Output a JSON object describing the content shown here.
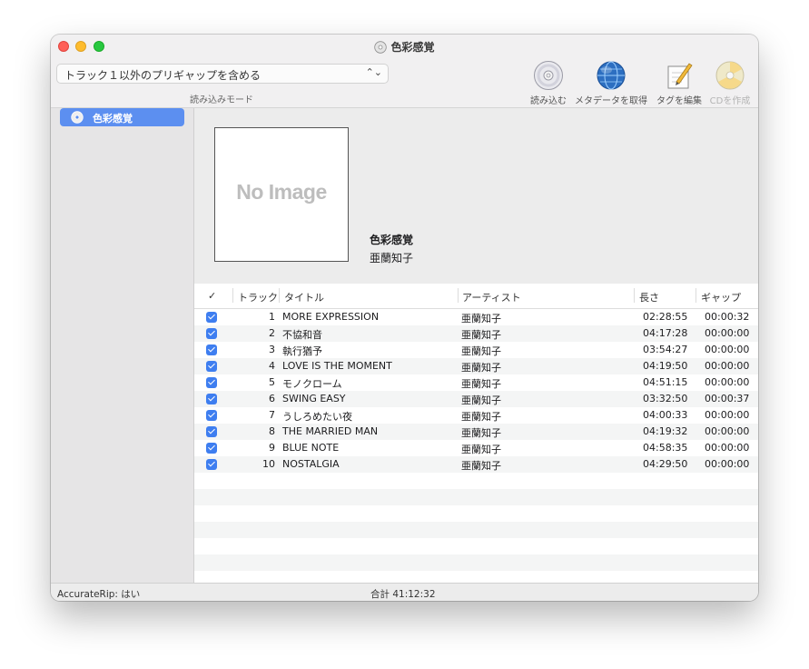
{
  "window": {
    "title": "色彩感覚"
  },
  "toolbar": {
    "mode_value": "トラック１以外のプリギャップを含める",
    "mode_label": "読み込みモード",
    "buttons": [
      {
        "label": "読み込む",
        "icon": "cd-icon",
        "enabled": true
      },
      {
        "label": "メタデータを取得",
        "icon": "globe-icon",
        "enabled": true
      },
      {
        "label": "タグを編集",
        "icon": "pencil-note-icon",
        "enabled": true
      },
      {
        "label": "CDを作成",
        "icon": "burn-cd-icon",
        "enabled": false
      }
    ]
  },
  "sidebar": {
    "items": [
      {
        "label": "色彩感覚",
        "icon": "cd-icon",
        "selected": true
      }
    ]
  },
  "album": {
    "artwork_placeholder": "No Image",
    "title": "色彩感覚",
    "artist": "亜蘭知子"
  },
  "table": {
    "columns": {
      "check": "✓",
      "track": "トラック",
      "title": "タイトル",
      "artist": "アーティスト",
      "length": "長さ",
      "gap": "ギャップ"
    },
    "rows": [
      {
        "checked": true,
        "track": "1",
        "title": "MORE EXPRESSION",
        "artist": "亜蘭知子",
        "length": "02:28:55",
        "gap": "00:00:32"
      },
      {
        "checked": true,
        "track": "2",
        "title": "不協和音",
        "artist": "亜蘭知子",
        "length": "04:17:28",
        "gap": "00:00:00"
      },
      {
        "checked": true,
        "track": "3",
        "title": "執行猶予",
        "artist": "亜蘭知子",
        "length": "03:54:27",
        "gap": "00:00:00"
      },
      {
        "checked": true,
        "track": "4",
        "title": "LOVE IS THE MOMENT",
        "artist": "亜蘭知子",
        "length": "04:19:50",
        "gap": "00:00:00"
      },
      {
        "checked": true,
        "track": "5",
        "title": "モノクローム",
        "artist": "亜蘭知子",
        "length": "04:51:15",
        "gap": "00:00:00"
      },
      {
        "checked": true,
        "track": "6",
        "title": "SWING EASY",
        "artist": "亜蘭知子",
        "length": "03:32:50",
        "gap": "00:00:37"
      },
      {
        "checked": true,
        "track": "7",
        "title": "うしろめたい夜",
        "artist": "亜蘭知子",
        "length": "04:00:33",
        "gap": "00:00:00"
      },
      {
        "checked": true,
        "track": "8",
        "title": "THE MARRIED MAN",
        "artist": "亜蘭知子",
        "length": "04:19:32",
        "gap": "00:00:00"
      },
      {
        "checked": true,
        "track": "9",
        "title": "BLUE NOTE",
        "artist": "亜蘭知子",
        "length": "04:58:35",
        "gap": "00:00:00"
      },
      {
        "checked": true,
        "track": "10",
        "title": "NOSTALGIA",
        "artist": "亜蘭知子",
        "length": "04:29:50",
        "gap": "00:00:00"
      }
    ]
  },
  "status": {
    "accuraterip": "AccurateRip: はい",
    "total": "合計 41:12:32"
  },
  "colors": {
    "accent": "#3e7ef0",
    "sidebar_selection": "#5c8ff0"
  }
}
